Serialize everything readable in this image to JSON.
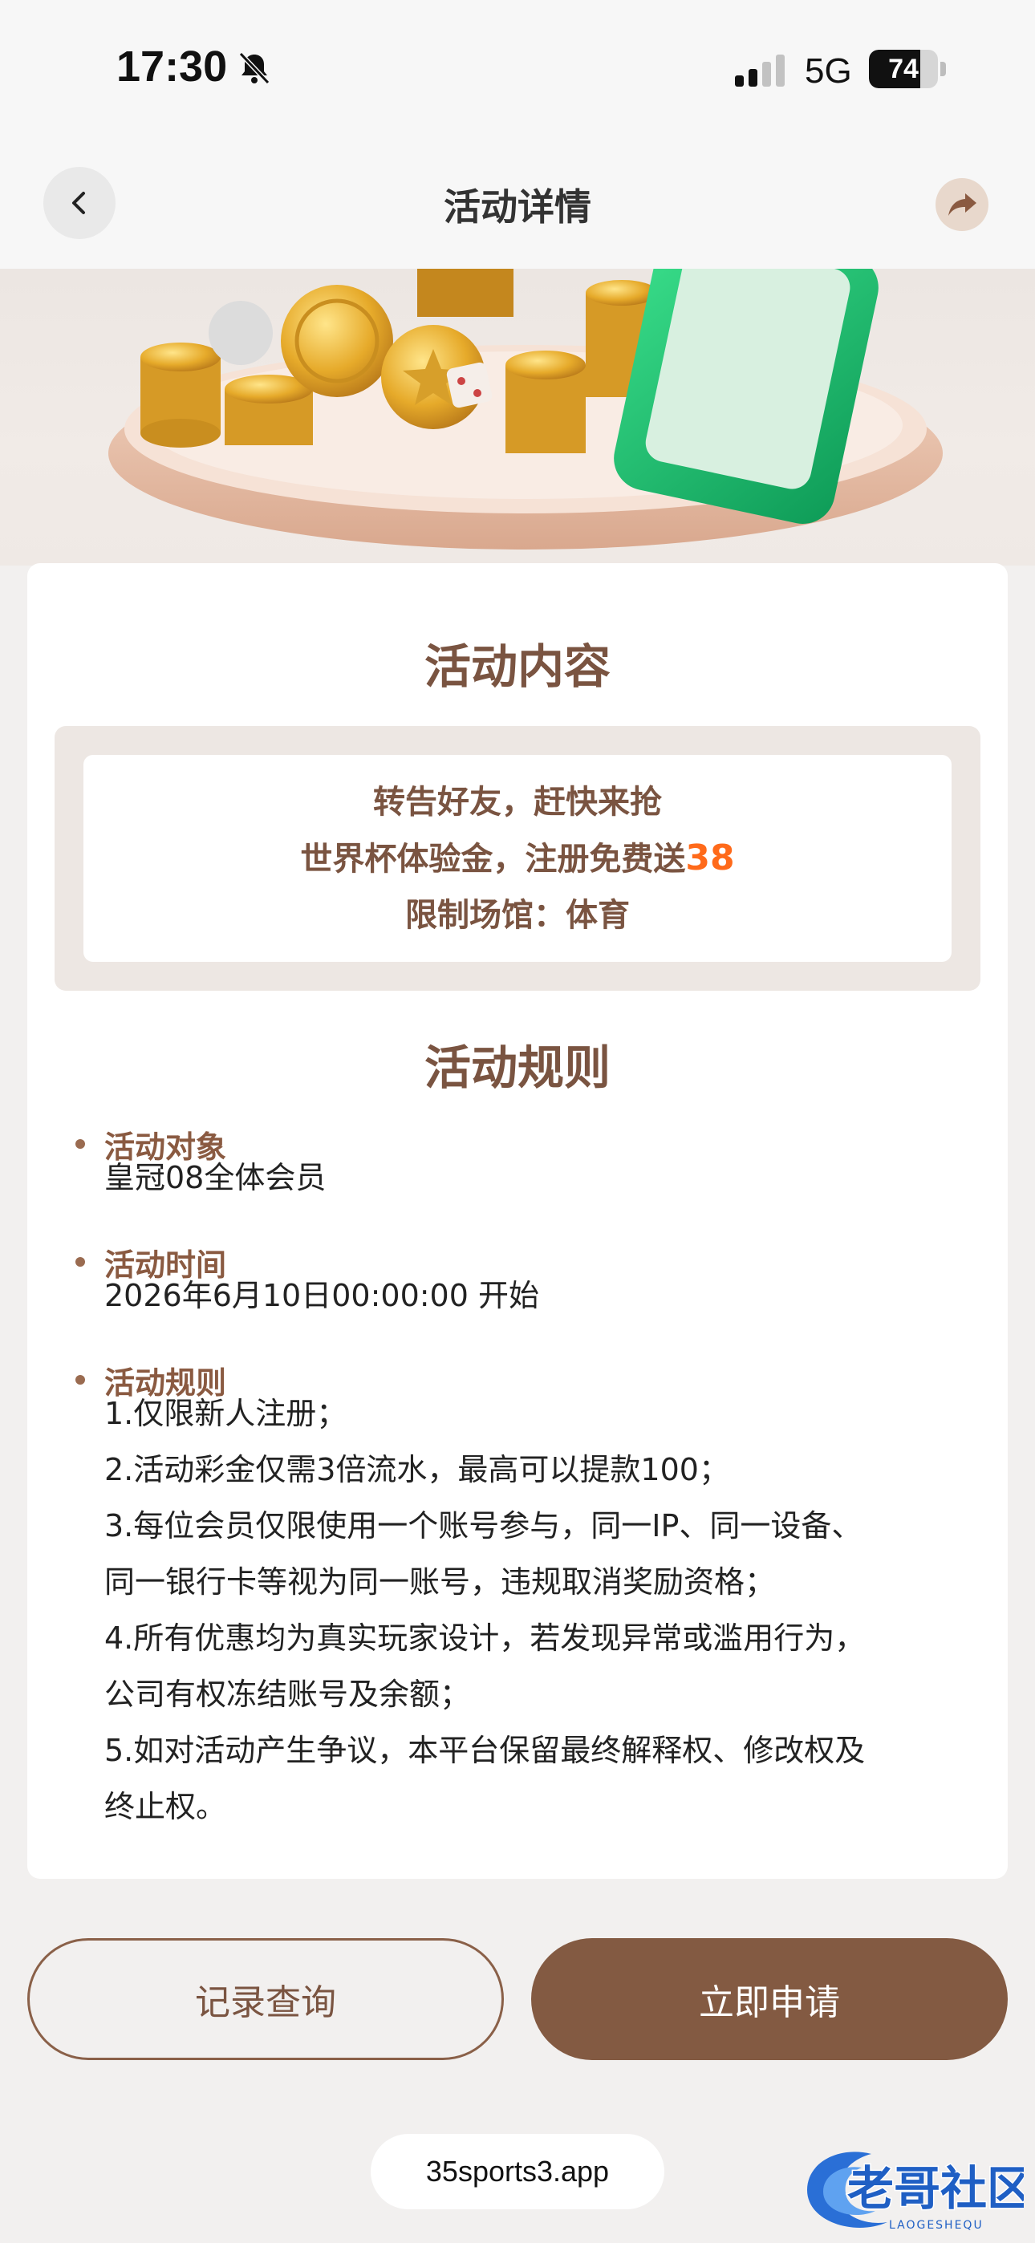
{
  "status_bar": {
    "time": "17:30",
    "network": "5G",
    "battery": "74",
    "battery_level": 0.74
  },
  "header": {
    "title": "活动详情"
  },
  "activity_content": {
    "title": "活动内容",
    "line1": "转告好友，赶快来抢",
    "line2_prefix": "世界杯体验金，注册免费送",
    "line2_amount": "38",
    "line3": "限制场馆：体育"
  },
  "rules": {
    "title": "活动规则",
    "target_label": "活动对象",
    "target_value": "皇冠08全体会员",
    "time_label": "活动时间",
    "time_value": "2026年6月10日00:00:00 开始",
    "rules_label": "活动规则",
    "items": [
      "1.仅限新人注册；",
      "2.活动彩金仅需3倍流水，最高可以提款100；",
      "3.每位会员仅限使用一个账号参与，同一IP、同一设备、",
      "同一银行卡等视为同一账号，违规取消奖励资格；",
      "4.所有优惠均为真实玩家设计，若发现异常或滥用行为，",
      "公司有权冻结账号及余额；",
      "5.如对活动产生争议，本平台保留最终解释权、修改权及",
      "终止权。"
    ]
  },
  "buttons": {
    "records": "记录查询",
    "apply": "立即申请"
  },
  "footer": {
    "url": "35sports3.app",
    "watermark_text": "老哥社区",
    "watermark_sub": "LAOGESHEQU"
  },
  "colors": {
    "accent_brown": "#835a42",
    "title_brown": "#7a5441",
    "highlight_orange": "#ff6a1a"
  }
}
